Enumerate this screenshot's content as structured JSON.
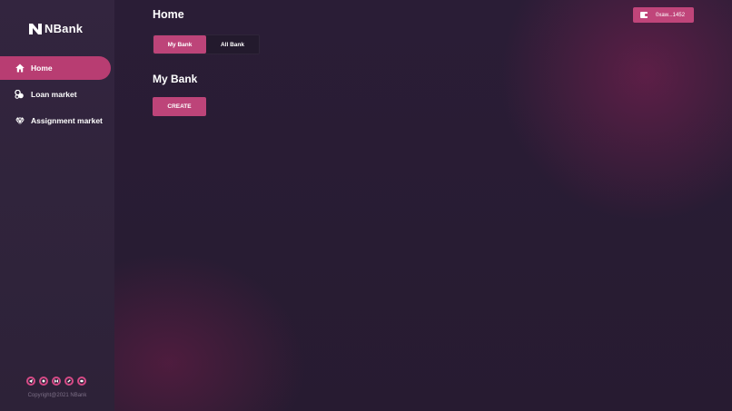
{
  "brand": {
    "name": "NBank",
    "logo_icon": "nbank-logo-icon"
  },
  "sidebar": {
    "items": [
      {
        "label": "Home",
        "icon": "home-icon",
        "active": true
      },
      {
        "label": "Loan market",
        "icon": "coins-icon",
        "active": false
      },
      {
        "label": "Assignment market",
        "icon": "diamond-icon",
        "active": false
      }
    ],
    "socials": [
      "telegram-icon",
      "github-icon",
      "medium-icon",
      "twitter-icon",
      "discord-icon"
    ],
    "copyright": "Copyright@2021 NBank"
  },
  "header": {
    "title": "Home",
    "wallet_label": "0xaw...1452",
    "wallet_icon": "wallet-icon"
  },
  "tabs": [
    {
      "label": "My Bank",
      "active": true
    },
    {
      "label": "All Bank",
      "active": false
    }
  ],
  "main": {
    "section_title": "My Bank",
    "create_label": "CREATE"
  },
  "colors": {
    "accent": "#bd4479",
    "sidebar_bg": "#2f2339",
    "main_bg": "#271b33"
  }
}
